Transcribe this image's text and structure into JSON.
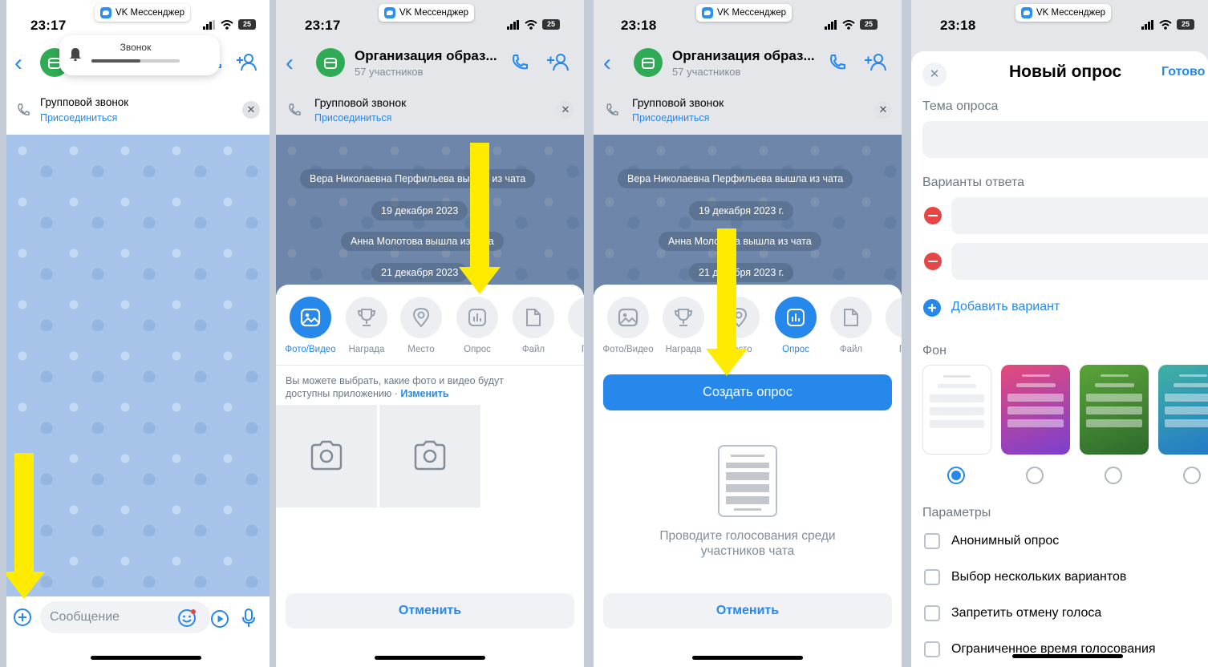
{
  "colors": {
    "accent": "#2688eb",
    "arrow": "#ffeb00",
    "group_avatar": "#2fab55",
    "danger": "#e64646"
  },
  "app_pill": "VK Мессенджер",
  "screen1": {
    "time": "23:17",
    "battery": "25",
    "call_popup_label": "Звонок",
    "call_bar": {
      "title": "Групповой звонок",
      "join": "Присоединиться"
    },
    "message_placeholder": "Сообщение"
  },
  "screen2": {
    "time": "23:17",
    "battery": "25",
    "chat_title": "Организация образ...",
    "members": "57 участников",
    "call_bar": {
      "title": "Групповой звонок",
      "join": "Присоединиться"
    },
    "service_messages": [
      "Вера Николаевна Перфильева вышла из чата",
      "19 декабря 2023",
      "Анна Молотова вышла из чата",
      "21 декабря 2023"
    ],
    "attachments": [
      {
        "label": "Фото/Видео",
        "icon": "photo-icon",
        "active": true
      },
      {
        "label": "Награда",
        "icon": "trophy-icon",
        "active": false
      },
      {
        "label": "Место",
        "icon": "location-icon",
        "active": false
      },
      {
        "label": "Опрос",
        "icon": "poll-icon",
        "active": false
      },
      {
        "label": "Файл",
        "icon": "file-icon",
        "active": false
      },
      {
        "label": "Гра",
        "icon": "graffiti-icon",
        "active": false
      }
    ],
    "permission_text": "Вы можете выбрать, какие фото и видео будут доступны приложению ·",
    "permission_link": "Изменить",
    "cancel": "Отменить"
  },
  "screen3": {
    "time": "23:18",
    "battery": "25",
    "chat_title": "Организация образ...",
    "members": "57 участников",
    "call_bar": {
      "title": "Групповой звонок",
      "join": "Присоединиться"
    },
    "service_messages": [
      "Вера Николаевна Перфильева вышла из чата",
      "19 декабря 2023 г.",
      "Анна Молотова вышла из чата",
      "21 декабря 2023 г."
    ],
    "attachments": [
      {
        "label": "Фото/Видео",
        "icon": "photo-icon",
        "active": false
      },
      {
        "label": "Награда",
        "icon": "trophy-icon",
        "active": false
      },
      {
        "label": "Место",
        "icon": "location-icon",
        "active": false
      },
      {
        "label": "Опрос",
        "icon": "poll-icon",
        "active": true
      },
      {
        "label": "Файл",
        "icon": "file-icon",
        "active": false
      },
      {
        "label": "Гра",
        "icon": "graffiti-icon",
        "active": false
      }
    ],
    "create_button": "Создать опрос",
    "empty_text": "Проводите голосования среди участников чата",
    "cancel": "Отменить"
  },
  "screen4": {
    "time": "23:18",
    "battery": "25",
    "title": "Новый опрос",
    "done": "Готово",
    "topic_label": "Тема опроса",
    "answers_label": "Варианты ответа",
    "add_option": "Добавить вариант",
    "background_label": "Фон",
    "params_label": "Параметры",
    "options": [
      "Анонимный опрос",
      "Выбор нескольких вариантов",
      "Запретить отмену голоса",
      "Ограниченное время голосования"
    ]
  }
}
